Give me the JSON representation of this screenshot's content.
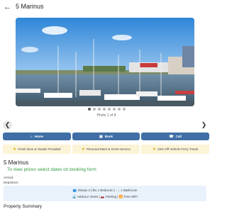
{
  "header": {
    "back_icon": "arrow-left-icon",
    "title": "5 Marinus"
  },
  "gallery": {
    "counter_text": "Photo 1 of 8",
    "total_photos": 8,
    "active_index": 0,
    "prev_icon": "chevron-left-icon",
    "next_icon": "chevron-right-icon"
  },
  "actions": [
    {
      "icon": "home-icon",
      "label": "Home"
    },
    {
      "icon": "book-icon",
      "label": "Book"
    },
    {
      "icon": "phone-icon",
      "label": "Call"
    }
  ],
  "features": [
    {
      "icon": "star-icon",
      "label": "Fresh linen & Towels Provided"
    },
    {
      "icon": "star-icon",
      "label": "Personal Meet & Greet Service"
    },
    {
      "icon": "star-icon",
      "label": "15% Off Vehicle Ferry Travel"
    }
  ],
  "property": {
    "name": "5 Marinus",
    "price_prompt": "To view prices select dates on booking form",
    "arrival_label": "Arrival:",
    "departure_label": "Departure:"
  },
  "amenities": {
    "line1": "👥 Sleeps 2 | 🛏 1 Bedroom | 🛁 1 Bathroom",
    "line2": "🌊 Harbour Views | 🚗 Parking | 📶 Free WiFi"
  },
  "summary_heading": "Property Summary",
  "colors": {
    "button": "#3f6fa6",
    "feature_bg": "#fbf4d6",
    "link_green": "#2e9b3c",
    "amenity_bg": "#e9f2fb"
  }
}
